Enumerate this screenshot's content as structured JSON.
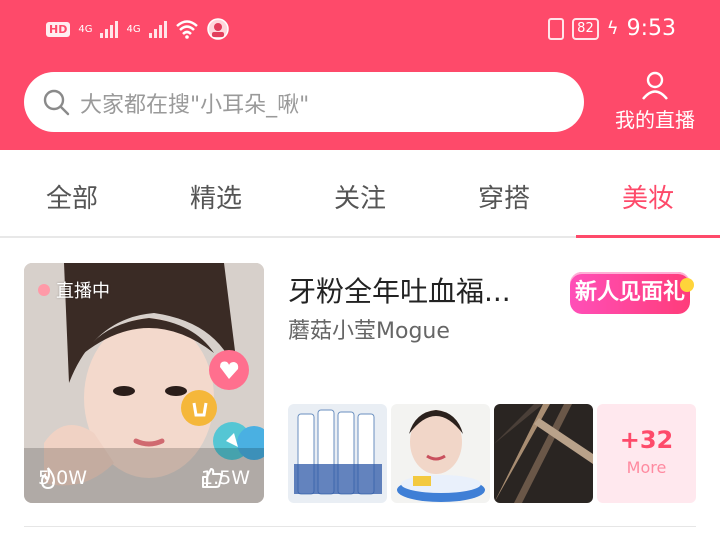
{
  "status_bar": {
    "hd": "HD",
    "net1": "4G",
    "net2": "4G",
    "battery": "82",
    "time": "9:53"
  },
  "search": {
    "placeholder": "大家都在搜\"小耳朵_啾\""
  },
  "header": {
    "my_live_label": "我的直播"
  },
  "tabs": [
    {
      "label": "全部"
    },
    {
      "label": "精选"
    },
    {
      "label": "关注"
    },
    {
      "label": "穿搭"
    },
    {
      "label": "美妆"
    }
  ],
  "active_tab": "美妆",
  "card": {
    "live_badge": "直播中",
    "heat": "5.0W",
    "likes": "1.5W",
    "title": "牙粉全年吐血福...",
    "gift_badge": "新人见面礼",
    "host": "蘑菇小莹Mogue",
    "more_count": "+32",
    "more_label": "More"
  },
  "colors": {
    "brand": "#fe4a6a",
    "more_bg": "#ffe8ee"
  }
}
